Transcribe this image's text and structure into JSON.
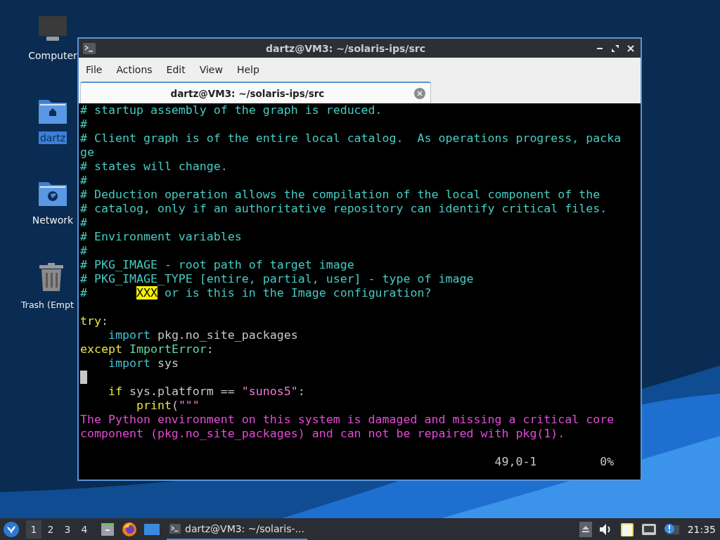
{
  "desktop_icons": [
    {
      "label": "Computer",
      "kind": "computer",
      "selected": false
    },
    {
      "label": "dartz",
      "kind": "home",
      "selected": true
    },
    {
      "label": "Network",
      "kind": "network",
      "selected": false
    },
    {
      "label": "Trash (Empt",
      "kind": "trash",
      "selected": false
    }
  ],
  "window": {
    "title": "dartz@VM3: ~/solaris-ips/src",
    "menu": [
      "File",
      "Actions",
      "Edit",
      "View",
      "Help"
    ],
    "tabs": [
      {
        "label": "dartz@VM3: ~/solaris-ips/src",
        "selected": true
      }
    ],
    "terminal": {
      "lines": [
        {
          "kind": "code",
          "segments": [
            {
              "kind": "comment",
              "text": "# startup assembly of the graph is reduced."
            }
          ]
        },
        {
          "kind": "code",
          "segments": [
            {
              "kind": "comment",
              "text": "#"
            }
          ]
        },
        {
          "kind": "code",
          "segments": [
            {
              "kind": "comment",
              "text": "# Client graph is of the entire local catalog.  As operations progress, packa"
            }
          ]
        },
        {
          "kind": "code",
          "segments": [
            {
              "kind": "comment",
              "text": "ge"
            }
          ]
        },
        {
          "kind": "code",
          "segments": [
            {
              "kind": "comment",
              "text": "# states will change."
            }
          ]
        },
        {
          "kind": "code",
          "segments": [
            {
              "kind": "comment",
              "text": "#"
            }
          ]
        },
        {
          "kind": "code",
          "segments": [
            {
              "kind": "comment",
              "text": "# Deduction operation allows the compilation of the local component of the"
            }
          ]
        },
        {
          "kind": "code",
          "segments": [
            {
              "kind": "comment",
              "text": "# catalog, only if an authoritative repository can identify critical files."
            }
          ]
        },
        {
          "kind": "code",
          "segments": [
            {
              "kind": "comment",
              "text": "#"
            }
          ]
        },
        {
          "kind": "code",
          "segments": [
            {
              "kind": "comment",
              "text": "# Environment variables"
            }
          ]
        },
        {
          "kind": "code",
          "segments": [
            {
              "kind": "comment",
              "text": "#"
            }
          ]
        },
        {
          "kind": "code",
          "segments": [
            {
              "kind": "comment",
              "text": "# PKG_IMAGE - root path of target image"
            }
          ]
        },
        {
          "kind": "code",
          "segments": [
            {
              "kind": "comment",
              "text": "# PKG_IMAGE_TYPE [entire, partial, user] - type of image"
            }
          ]
        },
        {
          "kind": "code",
          "segments": [
            {
              "kind": "comment",
              "text": "#       "
            },
            {
              "kind": "todo",
              "text": "XXX"
            },
            {
              "kind": "comment",
              "text": " or is this in the Image configuration?"
            }
          ]
        },
        {
          "kind": "blank"
        },
        {
          "kind": "code",
          "segments": [
            {
              "kind": "keyword",
              "text": "try"
            },
            {
              "kind": "plain",
              "text": ":"
            }
          ]
        },
        {
          "kind": "code",
          "segments": [
            {
              "kind": "statement",
              "text": "    import"
            },
            {
              "kind": "plain",
              "text": " pkg.no_site_packages"
            }
          ]
        },
        {
          "kind": "code",
          "segments": [
            {
              "kind": "keyword",
              "text": "except"
            },
            {
              "kind": "type",
              "text": " ImportError"
            },
            {
              "kind": "plain",
              "text": ":"
            }
          ]
        },
        {
          "kind": "code",
          "segments": [
            {
              "kind": "statement",
              "text": "    import"
            },
            {
              "kind": "plain",
              "text": " sys"
            }
          ]
        },
        {
          "kind": "cursor"
        },
        {
          "kind": "code",
          "segments": [
            {
              "kind": "keyword",
              "text": "    if"
            },
            {
              "kind": "plain",
              "text": " sys.platform == "
            },
            {
              "kind": "string",
              "text": "\"sunos5\""
            },
            {
              "kind": "plain",
              "text": ":"
            }
          ]
        },
        {
          "kind": "code",
          "segments": [
            {
              "kind": "keyword",
              "text": "        print"
            },
            {
              "kind": "plain",
              "text": "("
            },
            {
              "kind": "string",
              "text": "\"\"\""
            }
          ]
        },
        {
          "kind": "code",
          "segments": [
            {
              "kind": "error",
              "text": "The Python environment on this system is damaged and missing a critical core"
            }
          ]
        },
        {
          "kind": "code",
          "segments": [
            {
              "kind": "error",
              "text": "component (pkg.no_site_packages) and can not be repaired with pkg(1)."
            }
          ]
        },
        {
          "kind": "blank"
        }
      ],
      "status": {
        "position": "49,0-1",
        "scroll": "0%"
      }
    }
  },
  "taskbar": {
    "workspaces": [
      {
        "label": "1",
        "selected": true
      },
      {
        "label": "2",
        "selected": false
      },
      {
        "label": "3",
        "selected": false
      },
      {
        "label": "4",
        "selected": false
      }
    ],
    "tasks": [
      {
        "label": "dartz@VM3: ~/solaris-...",
        "selected": true
      }
    ],
    "clock": "21:35"
  }
}
